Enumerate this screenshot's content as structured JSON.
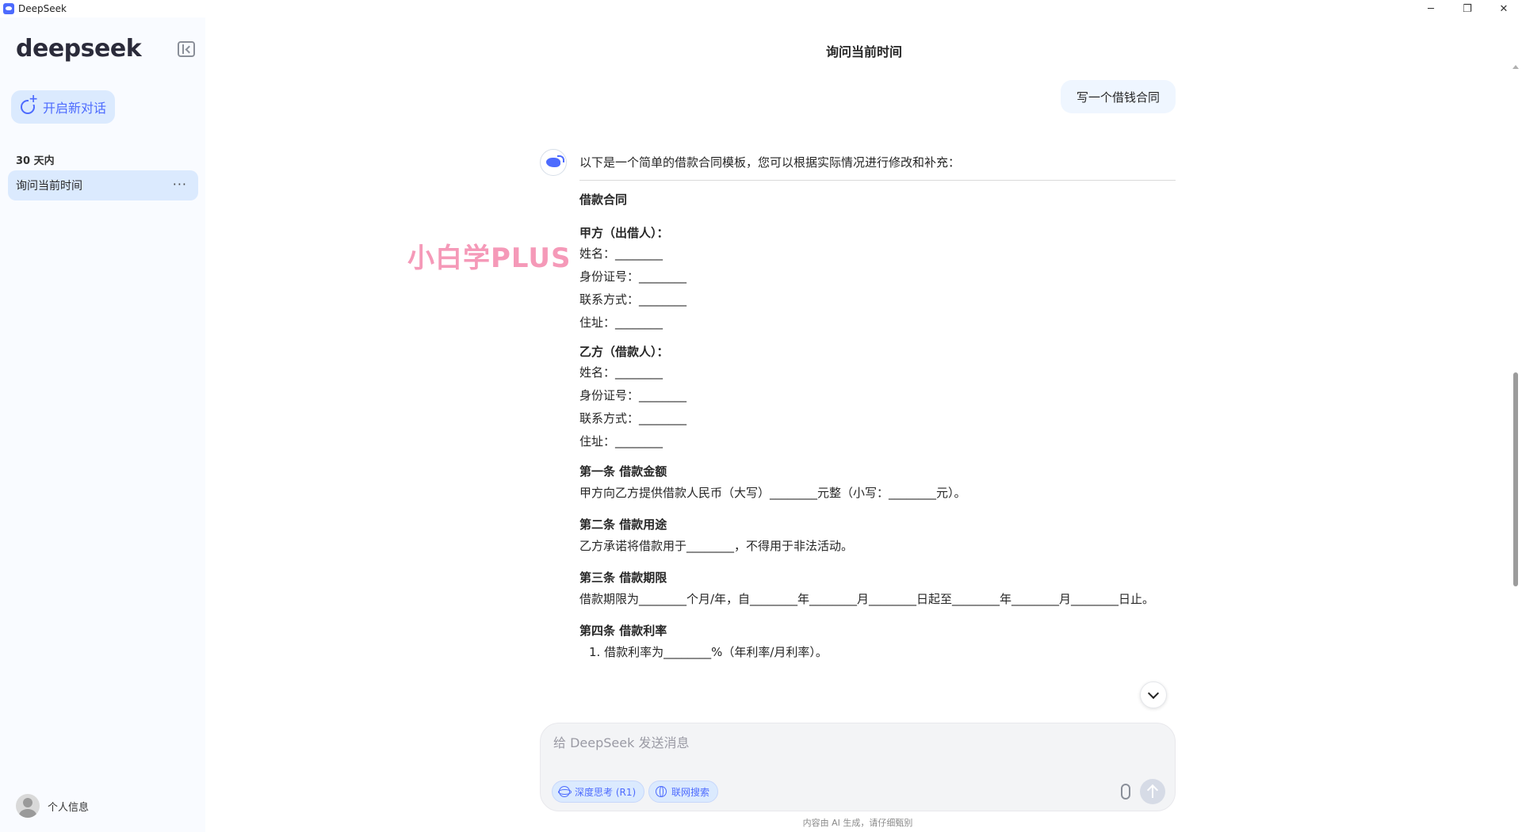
{
  "window": {
    "title": "DeepSeek",
    "controls": {
      "minimize": "─",
      "restore": "❐",
      "close": "✕"
    }
  },
  "sidebar": {
    "logo": "deepseek",
    "new_chat_label": "开启新对话",
    "section_label": "30 天内",
    "chats": [
      {
        "label": "询问当前时间",
        "more": "···"
      }
    ],
    "profile_label": "个人信息"
  },
  "main": {
    "chat_title": "询问当前时间",
    "user_message": "写一个借钱合同",
    "answer": {
      "intro": "以下是一个简单的借款合同模板，您可以根据实际情况进行修改和补充：",
      "doc_title": "借款合同",
      "party_a": {
        "title": "甲方（出借人）：",
        "fields": [
          "姓名：________",
          "身份证号：________",
          "联系方式：________",
          "住址：________"
        ]
      },
      "party_b": {
        "title": "乙方（借款人）：",
        "fields": [
          "姓名：________",
          "身份证号：________",
          "联系方式：________",
          "住址：________"
        ]
      },
      "articles": [
        {
          "title": "第一条 借款金额",
          "body": "甲方向乙方提供借款人民币（大写）________元整（小写：________元）。"
        },
        {
          "title": "第二条 借款用途",
          "body": "乙方承诺将借款用于________，不得用于非法活动。"
        },
        {
          "title": "第三条 借款期限",
          "body": "借款期限为________个月/年，自________年________月________日起至________年________月________日止。"
        },
        {
          "title": "第四条 借款利率",
          "list": [
            "1. 借款利率为________%（年利率/月利率）。"
          ]
        }
      ]
    },
    "watermark": "小白学PLUS"
  },
  "composer": {
    "placeholder": "给 DeepSeek 发送消息",
    "value": "",
    "deep_think_label": "深度思考 (R1)",
    "web_search_label": "联网搜索",
    "footer_note": "内容由 AI 生成，请仔细甄别"
  },
  "icons": {
    "app": "deepseek-whale-icon",
    "collapse": "sidebar-collapse-icon",
    "new_chat": "new-chat-icon",
    "avatar": "user-avatar-icon",
    "ai_avatar": "deepseek-whale-icon",
    "scroll_down": "chevron-down-icon",
    "attach": "paperclip-icon",
    "send": "arrow-up-icon"
  },
  "colors": {
    "accent": "#4d6bfe",
    "accent_bg": "#dbeafe",
    "sidebar_bg": "#f9fbff",
    "watermark": "#f48fb1"
  }
}
